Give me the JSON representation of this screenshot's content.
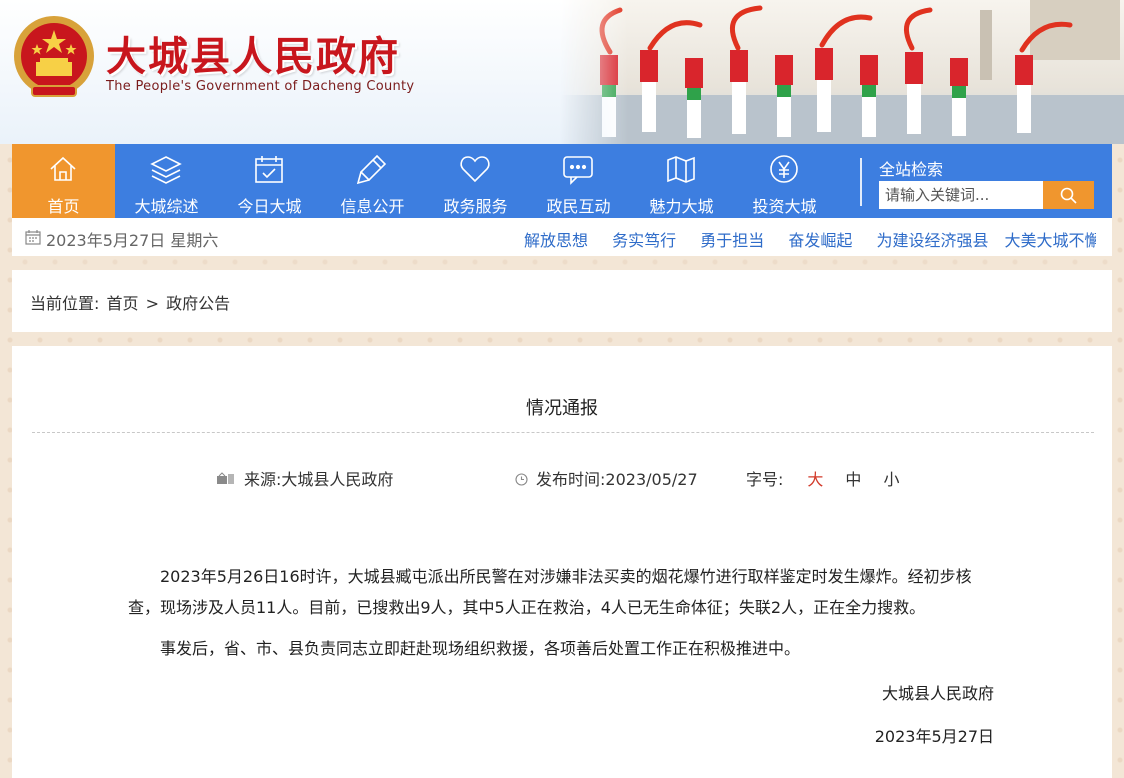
{
  "header": {
    "site_name": "大城县人民政府",
    "site_name_en": "The People's Government of Dacheng County"
  },
  "nav": {
    "items": [
      {
        "label": "首页",
        "icon": "home-icon",
        "active": true
      },
      {
        "label": "大城综述",
        "icon": "layers-icon"
      },
      {
        "label": "今日大城",
        "icon": "calendar-check-icon"
      },
      {
        "label": "信息公开",
        "icon": "pen-icon"
      },
      {
        "label": "政务服务",
        "icon": "heart-icon"
      },
      {
        "label": "政民互动",
        "icon": "chat-bubble-icon"
      },
      {
        "label": "魅力大城",
        "icon": "map-icon"
      },
      {
        "label": "投资大城",
        "icon": "yuan-icon"
      }
    ],
    "search_title": "全站检索",
    "search_placeholder": "请输入关键词..."
  },
  "datebar": {
    "date": "2023年5月27日 星期六",
    "slogans": [
      "解放思想",
      "务实笃行",
      "勇于担当",
      "奋发崛起",
      "为建设经济强县",
      "大美大城不懈奋斗"
    ]
  },
  "breadcrumb": {
    "prefix": "当前位置:",
    "home": "首页",
    "sep": ">",
    "current": "政府公告"
  },
  "article": {
    "title": "情况通报",
    "source_label": "来源:",
    "source": "大城县人民政府",
    "time_label": "发布时间:",
    "time": "2023/05/27",
    "font_size_label": "字号:",
    "font_big": "大",
    "font_mid": "中",
    "font_small": "小",
    "paragraphs": [
      "2023年5月26日16时许，大城县臧屯派出所民警在对涉嫌非法买卖的烟花爆竹进行取样鉴定时发生爆炸。经初步核查，现场涉及人员11人。目前，已搜救出9人，其中5人正在救治，4人已无生命体征；失联2人，正在全力搜救。",
      "事发后，省、市、县负责同志立即赶赴现场组织救援，各项善后处置工作正在积极推进中。"
    ],
    "signature": "大城县人民政府",
    "signature_date": "2023年5月27日"
  },
  "colors": {
    "nav_bg": "#3d7ee0",
    "nav_active": "#f0962e",
    "title_red": "#c8161d",
    "link_blue": "#2f6cc9"
  }
}
